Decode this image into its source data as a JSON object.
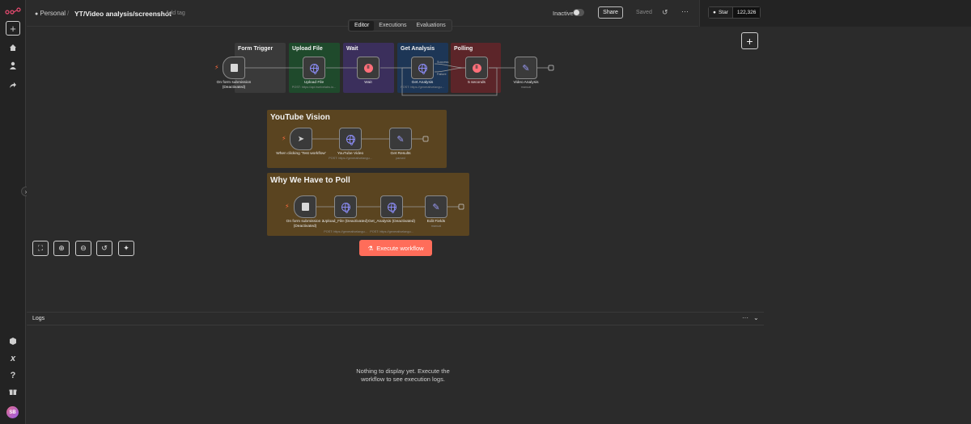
{
  "header": {
    "owner": "Personal",
    "separator": "/",
    "workflow_title": "YT/Video analysis/screenshot",
    "add_tag": "+ Add tag",
    "status_label": "Inactive",
    "share_label": "Share",
    "saved_label": "Saved",
    "tabs": [
      {
        "label": "Editor",
        "active": true
      },
      {
        "label": "Executions",
        "active": false
      },
      {
        "label": "Evaluations",
        "active": false
      }
    ],
    "github": {
      "star_label": "Star",
      "star_count": "122,326"
    }
  },
  "sidebar": {
    "icons": [
      "plus-icon",
      "home-icon",
      "user-icon",
      "share-icon",
      "templates-icon",
      "variables-icon",
      "help-icon",
      "whats-new-icon"
    ],
    "help_glyph": "?",
    "variables_glyph": "x",
    "avatar_initials": "SB"
  },
  "canvas": {
    "top_group": {
      "stickies": [
        {
          "title": "Form Trigger",
          "color": "#3a3a3a"
        },
        {
          "title": "Upload File",
          "color": "#1f4a2c"
        },
        {
          "title": "Wait",
          "color": "#3b2f5c"
        },
        {
          "title": "Get Analysis",
          "color": "#1d3656"
        },
        {
          "title": "Polling",
          "color": "#5c2529"
        }
      ],
      "nodes": [
        {
          "label": "On form submission (Deactivated)",
          "sub": ""
        },
        {
          "label": "Upload File",
          "sub": "POST: https://api.twelvelabs.io..."
        },
        {
          "label": "Wait",
          "sub": ""
        },
        {
          "label": "Get Analysis",
          "sub": "POST: https://generativelangu..."
        },
        {
          "label": "5 seconds",
          "sub": ""
        },
        {
          "label": "Video Analysis",
          "sub": "manual"
        }
      ],
      "branch_labels": [
        "Success",
        "Failure"
      ]
    },
    "youtube_group": {
      "title": "YouTube Vision",
      "color": "#5a4420",
      "nodes": [
        {
          "label": "When clicking 'Test workflow'",
          "sub": ""
        },
        {
          "label": "YouTube Video",
          "sub": "POST: https://generativelangu..."
        },
        {
          "label": "Get Results",
          "sub": "parsed"
        }
      ]
    },
    "poll_group": {
      "title": "Why We Have to Poll",
      "color": "#5a4420",
      "nodes": [
        {
          "label": "On form submission 2 (Deactivated)",
          "sub": ""
        },
        {
          "label": "Upload_File (Deactivated)",
          "sub": "POST: https://generativelangu..."
        },
        {
          "label": "Get_Analysis (Deactivated)",
          "sub": "POST: https://generativelangu..."
        },
        {
          "label": "Edit Fields",
          "sub": "manual"
        }
      ]
    },
    "execute_label": "Execute workflow",
    "controls": [
      "fit-view-icon",
      "zoom-in-icon",
      "zoom-out-icon",
      "reset-zoom-icon",
      "tidy-up-icon"
    ]
  },
  "logs": {
    "title": "Logs",
    "empty_message": "Nothing to display yet. Execute the workflow to see execution logs."
  },
  "colors": {
    "accent": "#ff6d5a",
    "background": "#2b2b2b",
    "panel": "#232323"
  }
}
